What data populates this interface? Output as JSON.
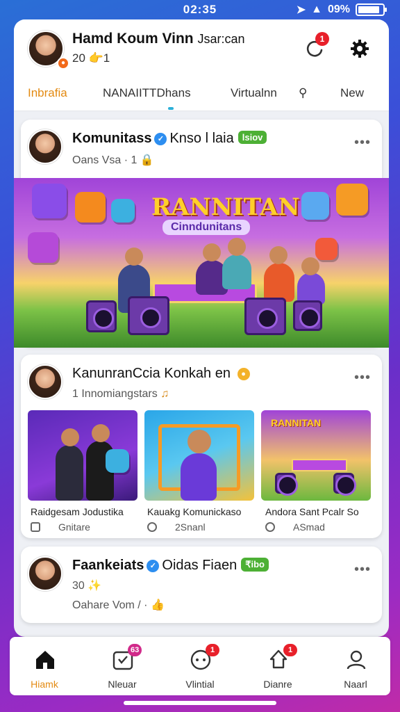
{
  "status": {
    "time": "02:35",
    "battery": "09%"
  },
  "colors": {
    "accent": "#e38a12",
    "badge": "#e8202a",
    "verified": "#2d8ef0",
    "tag": "#4db035"
  },
  "header": {
    "name": "Hamd Koum Vinn",
    "name_suffix": "Jsar:can",
    "sub": "20 👉1",
    "notif_count": "1",
    "refresh_icon": "refresh-icon",
    "settings_icon": "gear-icon"
  },
  "tabs": [
    {
      "label": "Inbrafia"
    },
    {
      "label": "NANAIITTDhans"
    },
    {
      "label": "Virtualnn"
    },
    {
      "label": "New"
    }
  ],
  "posts": [
    {
      "title": "Komunitass",
      "title_extra": "Knso l laia",
      "tag": "lsiov",
      "sub": "Oans  Vsa  · 1 🔒",
      "banner_title": "RANNITAN",
      "banner_sub": "Cinndunitans"
    },
    {
      "title": "KanunranCcia Konkah",
      "title_extra": "en",
      "sub": "1 Innomiangstars",
      "thumbs": [
        {
          "caption": "Raidgesam Jodustika",
          "meta": "Gnitare"
        },
        {
          "caption": "Kauakg Komunickaso",
          "meta": "2Snanl"
        },
        {
          "caption": "Andora Sant Pcalr So",
          "meta": "ASmad"
        }
      ],
      "thumb_title": "RANNITAN"
    },
    {
      "title": "Faankeiats",
      "title_extra": "Oidas Fiaen",
      "tag": "₹ibo",
      "sub": "30 ✨",
      "sub2": "Oahare   Vom  / · 👍"
    }
  ],
  "bottom_nav": [
    {
      "label": "Hiamk",
      "icon": "home-icon",
      "badge": ""
    },
    {
      "label": "Nleuar",
      "icon": "inbox-icon",
      "badge": "63"
    },
    {
      "label": "Vlintial",
      "icon": "chat-icon",
      "badge": "1"
    },
    {
      "label": "Dianre",
      "icon": "bell-icon",
      "badge": "1"
    },
    {
      "label": "Naarl",
      "icon": "profile-icon",
      "badge": ""
    }
  ]
}
